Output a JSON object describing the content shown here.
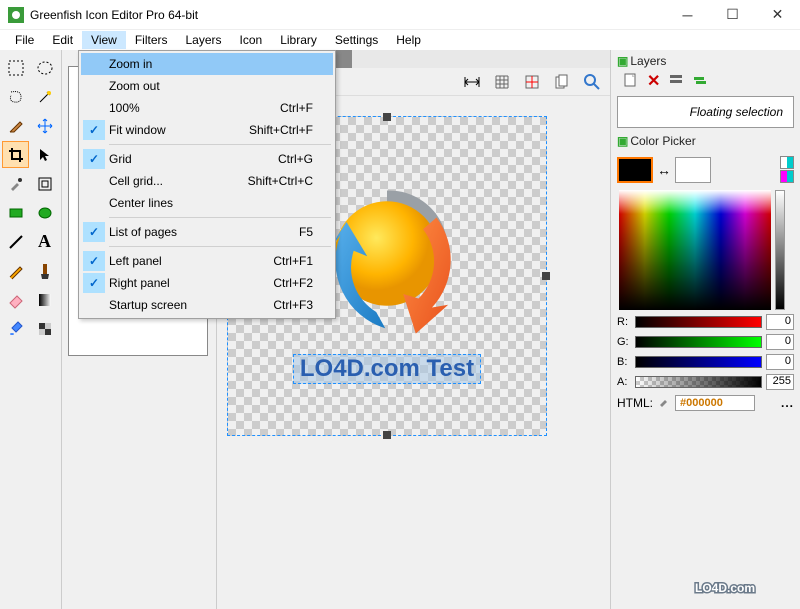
{
  "title": "Greenfish Icon Editor Pro 64-bit",
  "menu": [
    "File",
    "Edit",
    "View",
    "Filters",
    "Layers",
    "Icon",
    "Library",
    "Settings",
    "Help"
  ],
  "activeMenuIndex": 2,
  "viewMenu": [
    {
      "label": "Zoom in",
      "shortcut": "",
      "checked": false,
      "hover": true
    },
    {
      "label": "Zoom out",
      "shortcut": "",
      "checked": false
    },
    {
      "label": "100%",
      "shortcut": "Ctrl+F",
      "checked": false
    },
    {
      "label": "Fit window",
      "shortcut": "Shift+Ctrl+F",
      "checked": true
    },
    {
      "sep": true
    },
    {
      "label": "Grid",
      "shortcut": "Ctrl+G",
      "checked": true
    },
    {
      "label": "Cell grid...",
      "shortcut": "Shift+Ctrl+C",
      "checked": false
    },
    {
      "label": "Center lines",
      "shortcut": "",
      "checked": false
    },
    {
      "sep": true
    },
    {
      "label": "List of pages",
      "shortcut": "F5",
      "checked": true
    },
    {
      "sep": true
    },
    {
      "label": "Left panel",
      "shortcut": "Ctrl+F1",
      "checked": true
    },
    {
      "label": "Right panel",
      "shortcut": "Ctrl+F2",
      "checked": true
    },
    {
      "label": "Startup screen",
      "shortcut": "Ctrl+F3",
      "checked": false
    }
  ],
  "docTabClose": "×",
  "layers": {
    "title": "Layers",
    "selection": "Floating selection"
  },
  "colorPicker": {
    "title": "Color Picker"
  },
  "rgba": {
    "r": "0",
    "g": "0",
    "b": "0",
    "a": "255"
  },
  "rgbaLabels": {
    "r": "R:",
    "g": "G:",
    "b": "B:",
    "a": "A:"
  },
  "htmlLabel": "HTML:",
  "htmlValue": "#000000",
  "canvasText": "LO4D.com Test",
  "watermark": "LO4D.com"
}
